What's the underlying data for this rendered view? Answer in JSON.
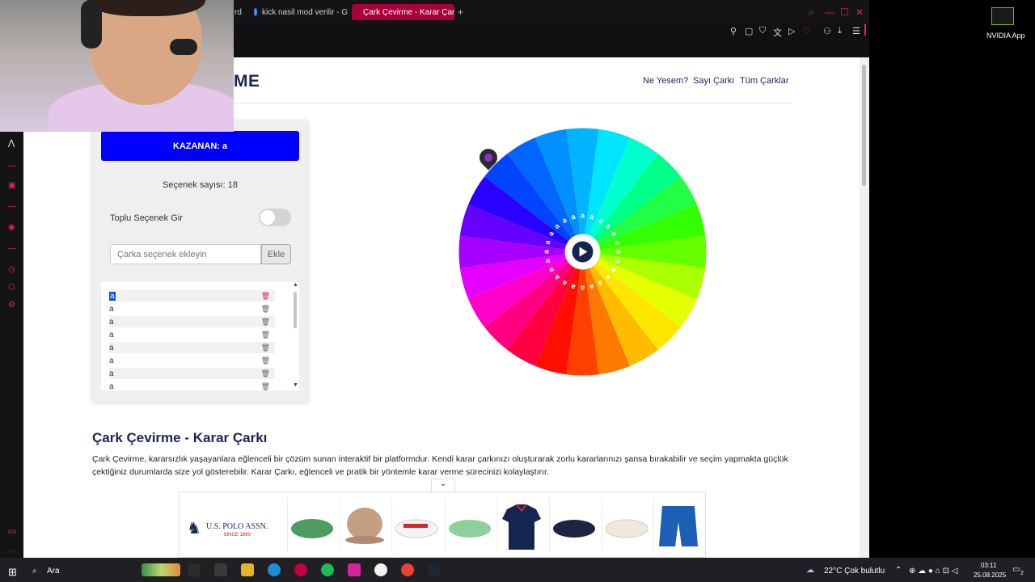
{
  "browser": {
    "tabs": [
      {
        "label": "rd"
      },
      {
        "label": "kick nasil mod verilir - Go"
      },
      {
        "label": "Çark Çevirme - Karar Çark"
      }
    ],
    "new_tab": "+"
  },
  "site": {
    "logo": "ME",
    "nav": [
      "Ne Yesem?",
      "Sayı Çarkı",
      "Tüm Çarklar"
    ]
  },
  "panel": {
    "winner_label": "KAZANAN: a",
    "option_count": "Seçenek sayısı: 18",
    "bulk_label": "Toplu Seçenek Gir",
    "input_placeholder": "Çarka seçenek ekleyin",
    "add_button": "Ekle",
    "options": [
      "a",
      "a",
      "a",
      "a",
      "a",
      "a",
      "a",
      "a"
    ]
  },
  "wheel": {
    "segment_count": 18,
    "segment_label": "a",
    "colors": [
      "#00b4ff",
      "#00e5ff",
      "#00ffcc",
      "#00ff88",
      "#22ff44",
      "#33ff00",
      "#66ff00",
      "#aaff00",
      "#e5ff00",
      "#ffe600",
      "#ffbb00",
      "#ff7a00",
      "#ff4000",
      "#ff0f00",
      "#ff0040",
      "#ff0080",
      "#ff00c8",
      "#e600ff",
      "#a600ff",
      "#6600ff",
      "#2a00ff",
      "#0044ff",
      "#0066ff",
      "#0090ff"
    ]
  },
  "article": {
    "title": "Çark Çevirme - Karar Çarkı",
    "text": "Çark Çevirme, kararsızlık yaşayanlara eğlenceli bir çözüm sunan interaktif bir platformdur. Kendi karar çarkınızı oluşturarak zorlu kararlarınızı şansa bırakabilir ve seçim yapmakta güçlük çektiğiniz durumlarda size yol gösterebilir. Karar Çarkı, eğlenceli ve pratik bir yöntemle karar verme sürecinizi kolaylaştırır."
  },
  "ad": {
    "brand": "U.S. POLO ASSN.",
    "since": "SINCE 1890"
  },
  "nvidia": {
    "label": "NVIDIA App"
  },
  "taskbar": {
    "search": "Ara",
    "weather": "22°C  Çok bulutlu",
    "time": "03:11",
    "date": "25.08.2025",
    "notif": "2"
  }
}
